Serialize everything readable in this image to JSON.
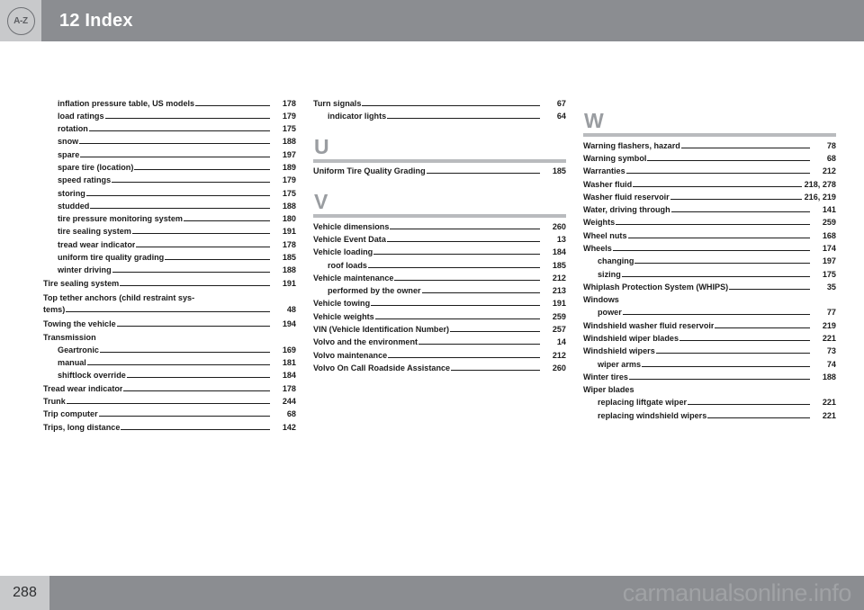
{
  "header": {
    "chapter_number": "12",
    "title": "12 Index",
    "badge_label": "A-Z"
  },
  "side_tab": {
    "chapter": "12"
  },
  "footer": {
    "page_number": "288",
    "watermark": "carmanualsonline.info"
  },
  "columns": [
    {
      "id": "column-1",
      "sections": [
        {
          "letter": null,
          "entries": [
            {
              "label": "inflation pressure table, US models",
              "page": "178",
              "level": "sub"
            },
            {
              "label": "load ratings",
              "page": "179",
              "level": "sub"
            },
            {
              "label": "rotation",
              "page": "175",
              "level": "sub"
            },
            {
              "label": "snow",
              "page": "188",
              "level": "sub"
            },
            {
              "label": "spare",
              "page": "197",
              "level": "sub"
            },
            {
              "label": "spare tire (location)",
              "page": "189",
              "level": "sub"
            },
            {
              "label": "speed ratings",
              "page": "179",
              "level": "sub"
            },
            {
              "label": "storing",
              "page": "175",
              "level": "sub"
            },
            {
              "label": "studded",
              "page": "188",
              "level": "sub"
            },
            {
              "label": "tire pressure monitoring system",
              "page": "180",
              "level": "sub"
            },
            {
              "label": "tire sealing system",
              "page": "191",
              "level": "sub"
            },
            {
              "label": "tread wear indicator",
              "page": "178",
              "level": "sub"
            },
            {
              "label": "uniform tire quality grading",
              "page": "185",
              "level": "sub"
            },
            {
              "label": "winter driving",
              "page": "188",
              "level": "sub"
            },
            {
              "label": "Tire sealing system",
              "page": "191",
              "level": "main"
            },
            {
              "label": "Top tether anchors (child restraint sys-",
              "label2": "tems)",
              "page": "48",
              "level": "main",
              "wrapped": true
            },
            {
              "label": "Towing the vehicle",
              "page": "194",
              "level": "main"
            },
            {
              "label": "Transmission",
              "page": "",
              "level": "main",
              "nopage": true
            },
            {
              "label": "Geartronic",
              "page": "169",
              "level": "sub"
            },
            {
              "label": "manual",
              "page": "181",
              "level": "sub"
            },
            {
              "label": "shiftlock override",
              "page": "184",
              "level": "sub"
            },
            {
              "label": "Tread wear indicator",
              "page": "178",
              "level": "main"
            },
            {
              "label": "Trunk",
              "page": "244",
              "level": "main"
            },
            {
              "label": "Trip computer",
              "page": "68",
              "level": "main"
            },
            {
              "label": "Trips, long distance",
              "page": "142",
              "level": "main"
            }
          ]
        }
      ]
    },
    {
      "id": "column-2",
      "sections": [
        {
          "letter": null,
          "entries": [
            {
              "label": "Turn signals",
              "page": "67",
              "level": "main"
            },
            {
              "label": "indicator lights",
              "page": "64",
              "level": "sub"
            }
          ]
        },
        {
          "letter": "U",
          "entries": [
            {
              "label": "Uniform Tire Quality Grading",
              "page": "185",
              "level": "main"
            }
          ]
        },
        {
          "letter": "V",
          "entries": [
            {
              "label": "Vehicle dimensions",
              "page": "260",
              "level": "main"
            },
            {
              "label": "Vehicle Event Data",
              "page": "13",
              "level": "main"
            },
            {
              "label": "Vehicle loading",
              "page": "184",
              "level": "main"
            },
            {
              "label": "roof loads",
              "page": "185",
              "level": "sub"
            },
            {
              "label": "Vehicle maintenance",
              "page": "212",
              "level": "main"
            },
            {
              "label": "performed by the owner",
              "page": "213",
              "level": "sub"
            },
            {
              "label": "Vehicle towing",
              "page": "191",
              "level": "main"
            },
            {
              "label": "Vehicle weights",
              "page": "259",
              "level": "main"
            },
            {
              "label": "VIN (Vehicle Identification Number)",
              "page": "257",
              "level": "main"
            },
            {
              "label": "Volvo and the environment",
              "page": "14",
              "level": "main"
            },
            {
              "label": "Volvo maintenance",
              "page": "212",
              "level": "main"
            },
            {
              "label": "Volvo On Call Roadside Assistance",
              "page": "260",
              "level": "main"
            }
          ]
        }
      ]
    },
    {
      "id": "column-3",
      "sections": [
        {
          "letter": "W",
          "entries": [
            {
              "label": "Warning flashers, hazard",
              "page": "78",
              "level": "main"
            },
            {
              "label": "Warning symbol",
              "page": "68",
              "level": "main"
            },
            {
              "label": "Warranties",
              "page": "212",
              "level": "main"
            },
            {
              "label": "Washer fluid",
              "page": "218, 278",
              "level": "main"
            },
            {
              "label": "Washer fluid reservoir",
              "page": "216, 219",
              "level": "main"
            },
            {
              "label": "Water, driving through",
              "page": "141",
              "level": "main"
            },
            {
              "label": "Weights",
              "page": "259",
              "level": "main"
            },
            {
              "label": "Wheel nuts",
              "page": "168",
              "level": "main"
            },
            {
              "label": "Wheels",
              "page": "174",
              "level": "main"
            },
            {
              "label": "changing",
              "page": "197",
              "level": "sub"
            },
            {
              "label": "sizing",
              "page": "175",
              "level": "sub"
            },
            {
              "label": "Whiplash Protection System (WHIPS)",
              "page": "35",
              "level": "main"
            },
            {
              "label": "Windows",
              "page": "",
              "level": "main",
              "nopage": true
            },
            {
              "label": "power",
              "page": "77",
              "level": "sub"
            },
            {
              "label": "Windshield washer fluid reservoir",
              "page": "219",
              "level": "main"
            },
            {
              "label": "Windshield wiper blades",
              "page": "221",
              "level": "main"
            },
            {
              "label": "Windshield wipers",
              "page": "73",
              "level": "main"
            },
            {
              "label": "wiper arms",
              "page": "74",
              "level": "sub"
            },
            {
              "label": "Winter tires",
              "page": "188",
              "level": "main"
            },
            {
              "label": "Wiper blades",
              "page": "",
              "level": "main",
              "nopage": true
            },
            {
              "label": "replacing liftgate wiper",
              "page": "221",
              "level": "sub"
            },
            {
              "label": "replacing windshield wipers",
              "page": "221",
              "level": "sub"
            }
          ]
        }
      ]
    }
  ]
}
